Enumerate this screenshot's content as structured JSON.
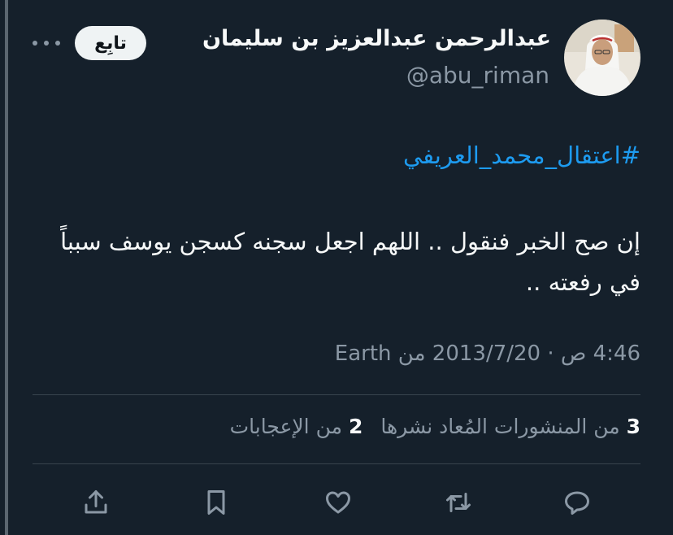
{
  "author": {
    "display_name": "عبدالرحمن عبدالعزيز بن سليمان",
    "handle": "@abu_riman",
    "avatar_icon": "profile-photo"
  },
  "header": {
    "follow_label": "تابِع",
    "more_icon": "more-dots-icon"
  },
  "tweet": {
    "hashtag": "#اعتقال_محمد_العريفي",
    "text": "إن صح الخبر فنقول .. اللهم اجعل سجنه كسجن يوسف سبباً في رفعته ..",
    "timestamp": "4:46 ص · 2013/7/20",
    "source": "من Earth"
  },
  "stats": {
    "reposts_count": "3",
    "reposts_label": "من المنشورات المُعاد نشرها",
    "likes_count": "2",
    "likes_label": "من الإعجابات"
  },
  "actions": {
    "reply_icon": "reply-icon",
    "repost_icon": "repost-icon",
    "like_icon": "heart-icon",
    "bookmark_icon": "bookmark-icon",
    "share_icon": "share-icon"
  },
  "colors": {
    "background": "#15202b",
    "text_primary": "#f7f9f9",
    "text_secondary": "#8b98a5",
    "accent": "#1d9bf0",
    "divider": "#38444d"
  }
}
